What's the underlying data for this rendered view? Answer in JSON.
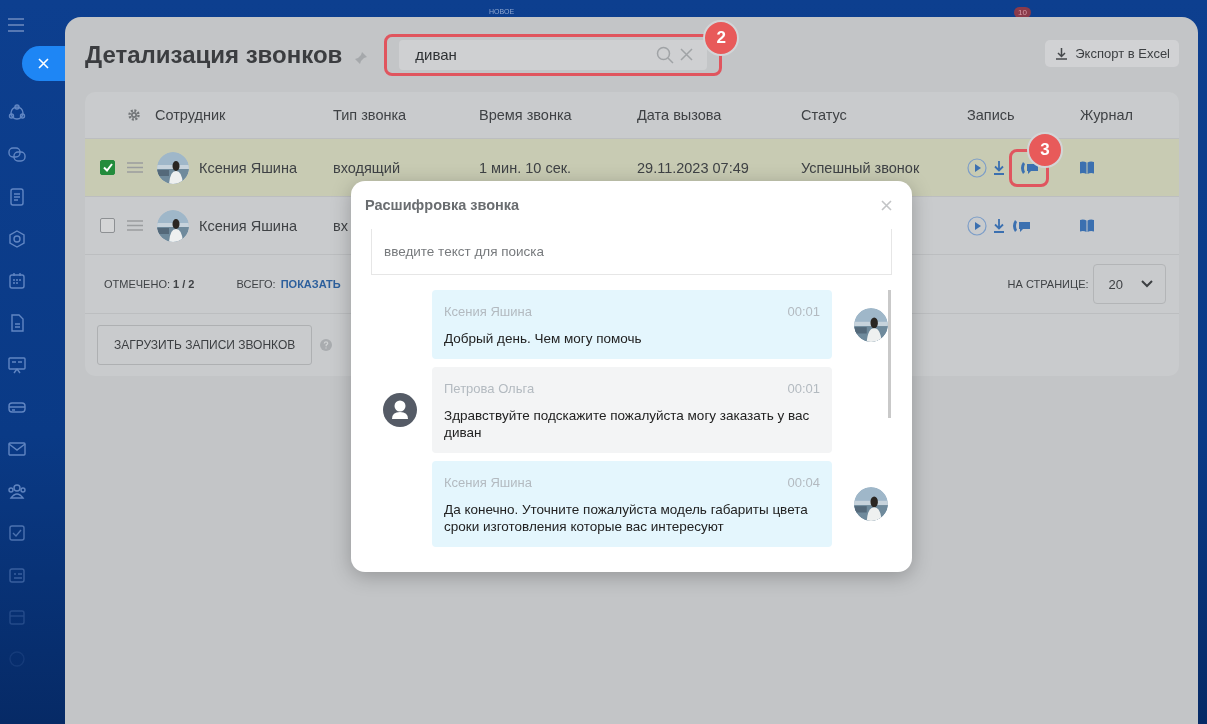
{
  "top_bar": {
    "new_label": "НОВОЕ",
    "badge": "10"
  },
  "page": {
    "title": "Детализация звонков",
    "search": {
      "value": "диван",
      "callout": "2"
    },
    "export_button": "Экспорт в Excel"
  },
  "table": {
    "columns": [
      "Сотрудник",
      "Тип звонка",
      "Время звонка",
      "Дата вызова",
      "Статус",
      "Запись",
      "Журнал"
    ],
    "rows": [
      {
        "selected": true,
        "employee": "Ксения Яшина",
        "type": "входящий",
        "duration": "1 мин. 10 сек.",
        "date": "29.11.2023 07:49",
        "status": "Успешный звонок",
        "callout": "3"
      },
      {
        "selected": false,
        "employee": "Ксения Яшина",
        "type": "вх"
      }
    ],
    "footer": {
      "marked": "ОТМЕЧЕНО: **1 / 2**",
      "total_label": "ВСЕГО:",
      "total_link": "ПОКАЗАТЬ",
      "per_page_label": "НА СТРАНИЦЕ:",
      "per_page": "20"
    }
  },
  "upload_button": "ЗАГРУЗИТЬ ЗАПИСИ ЗВОНКОВ",
  "modal": {
    "title": "Расшифровка звонка",
    "search": {
      "placeholder": "введите текст для поиска"
    },
    "messages": [
      {
        "kind": "operator",
        "speaker": "Ксения Яшина",
        "time": "00:01",
        "text": "Добрый день. Чем могу помочь"
      },
      {
        "kind": "client",
        "speaker": "Петрова Ольга",
        "time": "00:01",
        "text": "Здравствуйте подскажите пожалуйста могу заказать у вас диван"
      },
      {
        "kind": "operator",
        "speaker": "Ксения Яшина",
        "time": "00:04",
        "text": "Да конечно. Уточните пожалуйста модель габариты цвета сроки изготовления которые вас интересуют"
      }
    ]
  }
}
